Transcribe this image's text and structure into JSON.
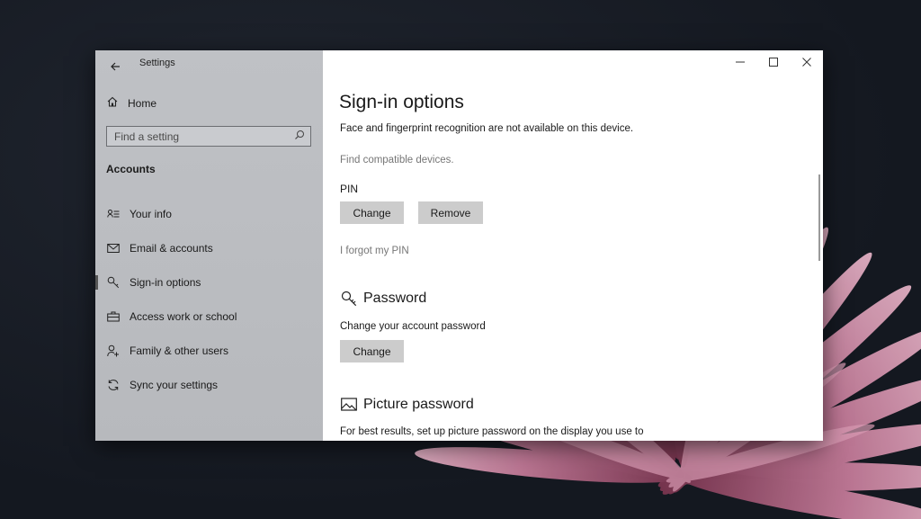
{
  "window": {
    "app_title": "Settings"
  },
  "sidebar": {
    "home_label": "Home",
    "search_placeholder": "Find a setting",
    "section_label": "Accounts",
    "items": [
      {
        "label": "Your info",
        "icon": "person-list-icon"
      },
      {
        "label": "Email & accounts",
        "icon": "mail-icon"
      },
      {
        "label": "Sign-in options",
        "icon": "key-icon",
        "active": true
      },
      {
        "label": "Access work or school",
        "icon": "briefcase-icon"
      },
      {
        "label": "Family & other users",
        "icon": "person-add-icon"
      },
      {
        "label": "Sync your settings",
        "icon": "sync-icon"
      }
    ]
  },
  "main": {
    "title": "Sign-in options",
    "face_notice": "Face and fingerprint recognition are not available on this device.",
    "find_devices_link": "Find compatible devices.",
    "pin": {
      "label": "PIN",
      "change_button": "Change",
      "remove_button": "Remove",
      "forgot_link": "I forgot my PIN"
    },
    "password": {
      "heading": "Password",
      "description": "Change your account password",
      "change_button": "Change"
    },
    "picture_password": {
      "heading": "Picture password",
      "description": "For best results, set up picture password on the display you use to"
    }
  },
  "colors": {
    "sidebar_bg": "#bfc1c5",
    "button_bg": "#cccccc",
    "link_gray": "#767676"
  }
}
